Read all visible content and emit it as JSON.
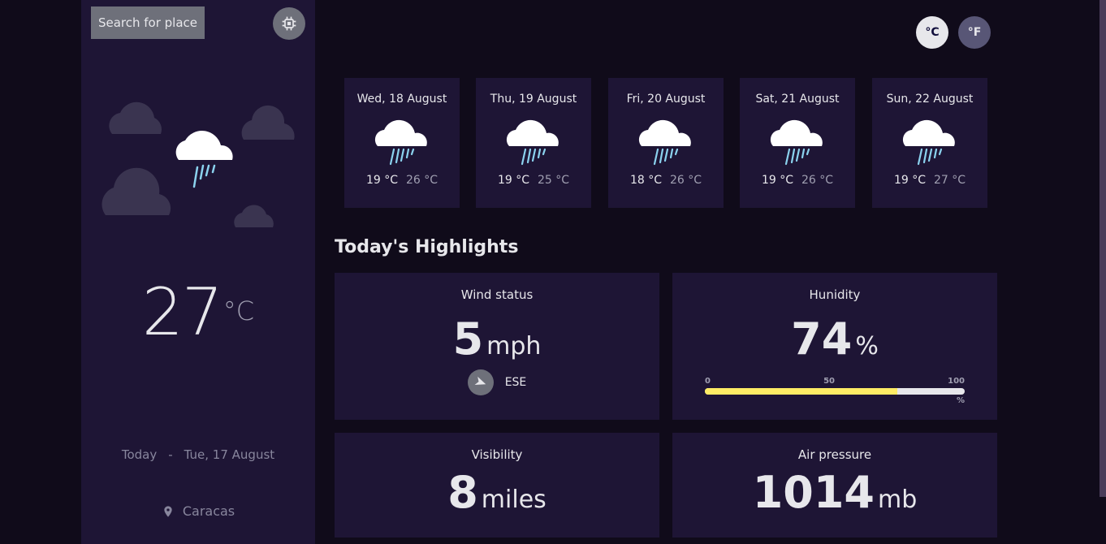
{
  "sidebar": {
    "search_label": "Search for place",
    "temperature": "27",
    "temperature_unit": "°C",
    "today_label": "Today",
    "separator": "-",
    "date": "Tue, 17 August",
    "location": "Caracas"
  },
  "units": {
    "celsius": "°C",
    "fahrenheit": "°F"
  },
  "forecast": [
    {
      "date": "Wed, 18 August",
      "max": "19 °C",
      "min": "26 °C"
    },
    {
      "date": "Thu, 19 August",
      "max": "19 °C",
      "min": "25 °C"
    },
    {
      "date": "Fri, 20 August",
      "max": "18 °C",
      "min": "26 °C"
    },
    {
      "date": "Sat, 21 August",
      "max": "19 °C",
      "min": "26 °C"
    },
    {
      "date": "Sun, 22 August",
      "max": "19 °C",
      "min": "27 °C"
    }
  ],
  "highlights": {
    "title": "Today's Highlights",
    "wind": {
      "label": "Wind status",
      "value": "5",
      "unit": "mph",
      "direction": "ESE"
    },
    "humidity": {
      "label": "Hunidity",
      "value": "74",
      "unit": "%",
      "tick_0": "0",
      "tick_50": "50",
      "tick_100": "100",
      "pct_label": "%",
      "percent": 74
    },
    "visibility": {
      "label": "Visibility",
      "value": "8",
      "unit": "miles"
    },
    "pressure": {
      "label": "Air pressure",
      "value": "1014",
      "unit": "mb"
    }
  },
  "colors": {
    "accent_yellow": "#ffec65",
    "panel": "#1e1535",
    "background": "#100b1a"
  },
  "icons": {
    "weather": "light-rain-icon",
    "locate": "gps-target-icon",
    "location": "map-pin-icon",
    "wind": "navigation-arrow-icon"
  }
}
